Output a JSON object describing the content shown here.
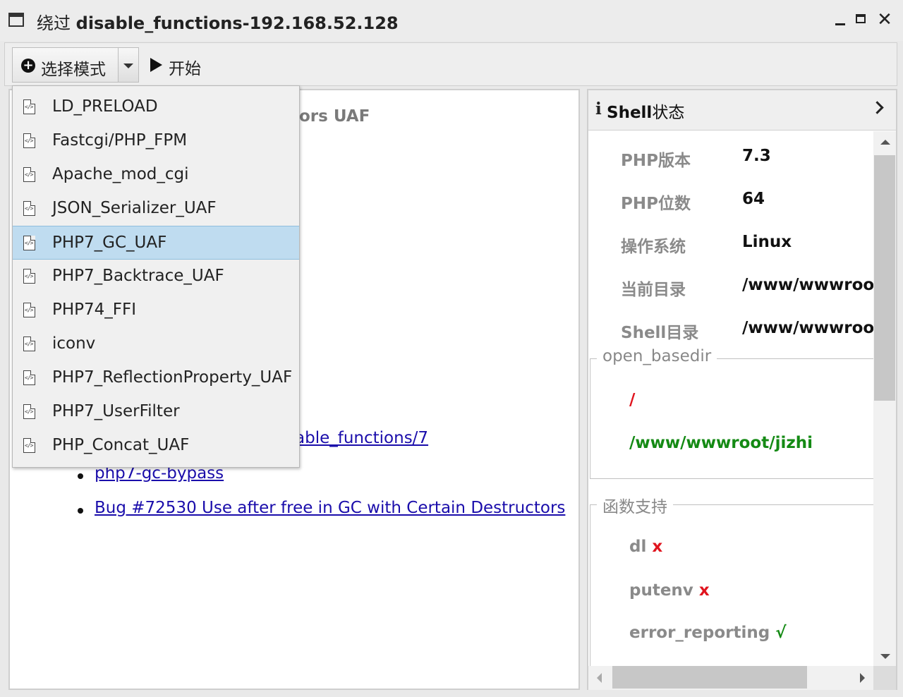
{
  "window": {
    "title_prefix": "绕过",
    "title_main": "disable_functions-192.168.52.128",
    "close_glyph": "✕"
  },
  "toolbar": {
    "mode_label": "选择模式",
    "start_label": "开始"
  },
  "mode_menu": {
    "items": [
      "LD_PRELOAD",
      "Fastcgi/PHP_FPM",
      "Apache_mod_cgi",
      "JSON_Serializer_UAF",
      "PHP7_GC_UAF",
      "PHP7_Backtrace_UAF",
      "PHP74_FFI",
      "iconv",
      "PHP7_ReflectionProperty_UAF",
      "PHP7_UserFilter",
      "PHP_Concat_UAF"
    ],
    "selected": "PHP7_GC_UAF"
  },
  "content": {
    "heading_fragment": "ors UAF",
    "link_partial": "able_functions/7",
    "refs": [
      "php7-gc-bypass",
      "Bug #72530 Use after free in GC with Certain Destructors"
    ]
  },
  "shell_status": {
    "info_glyph": "i",
    "title_bold": "Shell",
    "title_rest": "状态",
    "rows": [
      {
        "label": "PHP版本",
        "value": "7.3"
      },
      {
        "label": "PHP位数",
        "value": "64"
      },
      {
        "label": "操作系统",
        "value": "Linux"
      },
      {
        "label": "当前目录",
        "value": "/www/wwwroo"
      },
      {
        "label": "Shell目录",
        "value": "/www/wwwroo"
      }
    ],
    "open_basedir": {
      "legend": "open_basedir",
      "paths": [
        {
          "text": "/",
          "color": "#e0141e"
        },
        {
          "text": "/www/wwwroot/jizhi",
          "color": "#148a14"
        }
      ]
    },
    "functions": {
      "legend": "函数支持",
      "items": [
        {
          "name": "dl",
          "mark": "x",
          "supported": false
        },
        {
          "name": "putenv",
          "mark": "x",
          "supported": false
        },
        {
          "name": "error_reporting",
          "mark": "√",
          "supported": true
        }
      ]
    }
  },
  "colors": {
    "selected_bg": "#bfdcf0",
    "link": "#1a0dab",
    "error": "#e0141e",
    "ok": "#148a14"
  }
}
